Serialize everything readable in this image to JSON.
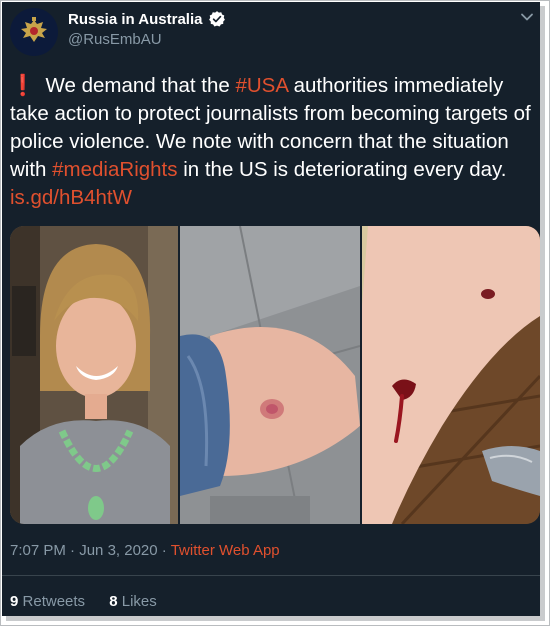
{
  "account": {
    "name": "Russia in Australia",
    "handle": "@RusEmbAU",
    "verified": true,
    "avatar_icon": "russian-coat-of-arms-icon"
  },
  "tweet": {
    "exclamation": "❗",
    "segments": [
      {
        "text": "We demand that the ",
        "type": "text"
      },
      {
        "text": "#USA",
        "type": "hashtag"
      },
      {
        "text": " authorities immediately take action to protect journalists from becoming targets of police violence. We note with concern that the situation with ",
        "type": "text"
      },
      {
        "text": "#mediaRights",
        "type": "hashtag"
      },
      {
        "text": " in the US is deteriorating every day. ",
        "type": "text"
      },
      {
        "text": "is.gd/hB4htW",
        "type": "link"
      }
    ]
  },
  "media": {
    "photos": [
      {
        "description_icon": "photo-smiling-woman"
      },
      {
        "description_icon": "photo-bruised-arm"
      },
      {
        "description_icon": "photo-bleeding-leg"
      }
    ]
  },
  "meta": {
    "time": "7:07 PM",
    "date": "Jun 3, 2020",
    "separator": "·",
    "app": "Twitter Web App"
  },
  "stats": {
    "retweets_count": "9",
    "retweets_label": "Retweets",
    "likes_count": "8",
    "likes_label": "Likes"
  },
  "colors": {
    "background": "#15202b",
    "accent": "#e0502e",
    "muted": "#8899a6",
    "verified": "#ffffff"
  }
}
